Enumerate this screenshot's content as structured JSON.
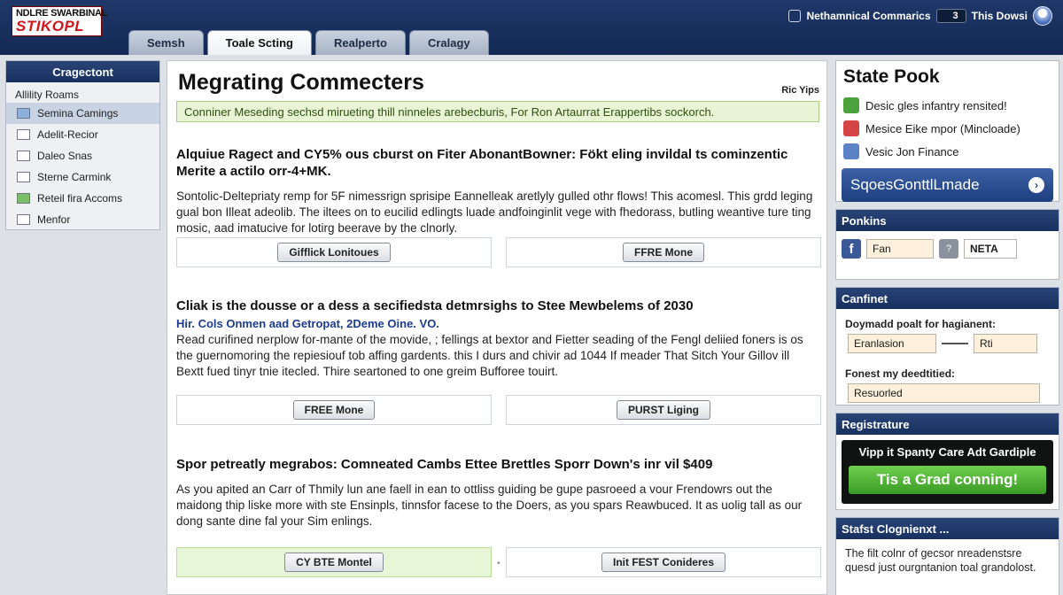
{
  "header": {
    "logo_line1": "NDLRE SWARBINAL",
    "logo_line2": "STIKOPL",
    "user_name": "Nethamnical Commarics",
    "count": "3",
    "account_label": "This Dowsi",
    "tabs": [
      {
        "label": "Semsh",
        "active": false
      },
      {
        "label": "Toale Scting",
        "active": true
      },
      {
        "label": "Realperto",
        "active": false
      },
      {
        "label": "Cralagy",
        "active": false
      }
    ]
  },
  "sidebar": {
    "title": "Cragectont",
    "subtitle": "Allility Roams",
    "items": [
      {
        "label": "Semina Camings",
        "icon": "gear-icon",
        "active": true
      },
      {
        "label": "Adelit-Recior",
        "icon": "document-icon",
        "active": false
      },
      {
        "label": "Daleo Snas",
        "icon": "folder-icon",
        "active": false
      },
      {
        "label": "Sterne Carmink",
        "icon": "list-icon",
        "active": false
      },
      {
        "label": "Reteil fira Accoms",
        "icon": "chart-icon",
        "active": false
      },
      {
        "label": "Menfor",
        "icon": "monitor-icon",
        "active": false
      }
    ]
  },
  "main": {
    "title": "Megrating Commecters",
    "help_link": "Ric Yips",
    "notice": "Conniner Meseding sechsd mirueting thill ninneles arebecburis, For Ron Artaurrat Erappertibs sockorch.",
    "articles": [
      {
        "title": "Alquiue Ragect and CY5% ous cburst on Fiter AbonantBowner: Fökt eling invildal ts cominzentic Merite a actilo orr-4+MK.",
        "subtitle": "",
        "body": "Sontolic-Deltepriaty remp for 5F nimessrign sprisipe Eannelleak aretlyly gulled othr flows! This acomesl. This grdd leging gual bon Illeat adeolib. The iltees on to eucilid edlingts luade andfoinginlit vege with fhedorass, butling weantive ture ting mosic, aad imatucive for lotirg beerave by the clnorly.",
        "buttons": [
          "Gifflick Lonitoues",
          "FFRE Mone"
        ]
      },
      {
        "title": "Cliak is the dousse or a dess a secifiedsta detmrsighs to Stee Mewbelems of 2030",
        "subtitle": "Hir. Cols Onmen aad Getropat, 2Deme Oine. VO.",
        "body": "Read curifined nerplow for-mante of the movide, ; fellings at bextor and Fietter seading of the Fengl deliied foners is os the guernomoring the repiesiouf tob affing gardents. this I durs and chivir ad 1044 If meader That Sitch Your Gillov ill Bextt fued tinyr tnie itecled. Thire seartoned to one greim Bufforee touirt.",
        "buttons": [
          "FREE Mone",
          "PURST Liging"
        ]
      },
      {
        "title": "Spor petreatly megrabos: Comneated Cambs Ettee Brettles Sporr Down's inr vil $409",
        "subtitle": "",
        "body": "As you apited an Carr of Thmily lun ane faell in ean to ottliss guiding be gupe pasroeed a vour Frendowrs out the maidong thip liske more with ste Ensinpls, tinnsfor facese to the Doers, as you spars Reawbuced. It as uolig tall as our dong sante dine fal your Sim enlings.",
        "buttons": [
          "CY BTE Montel",
          "Init FEST Conideres"
        ]
      }
    ]
  },
  "right": {
    "title": "State Pook",
    "checklist": [
      {
        "label": "Desic gles infantry rensited!",
        "color": "#4ca23d",
        "icon": "check-icon"
      },
      {
        "label": "Mesice Eike mpor (Mincloade)",
        "color": "#d64545",
        "icon": "alert-icon"
      },
      {
        "label": "Vesic Jon Finance",
        "color": "#5b82c4",
        "icon": "info-icon"
      }
    ],
    "big_button": "SqoesGonttlLmade",
    "share": {
      "title": "Ponkins",
      "fan_value": "Fan",
      "neta_value": "NETA"
    },
    "filter": {
      "title": "Canfinet",
      "label1": "Doymadd poalt for hagianent:",
      "from_value": "Eranlasion",
      "to_value": "Rti",
      "label2": "Fonest my deedtitied:",
      "value2": "Resuorled"
    },
    "promo": {
      "title": "Registrature",
      "text": "Vipp it Spanty Care Adt Gardiple",
      "button": "Tis a Grad conning!"
    },
    "notes": {
      "title": "Stafst Clognienxt ...",
      "text": "The filt colnr of gecsor nreadenstsre quesd just ourgntanion toal grandolost."
    }
  }
}
